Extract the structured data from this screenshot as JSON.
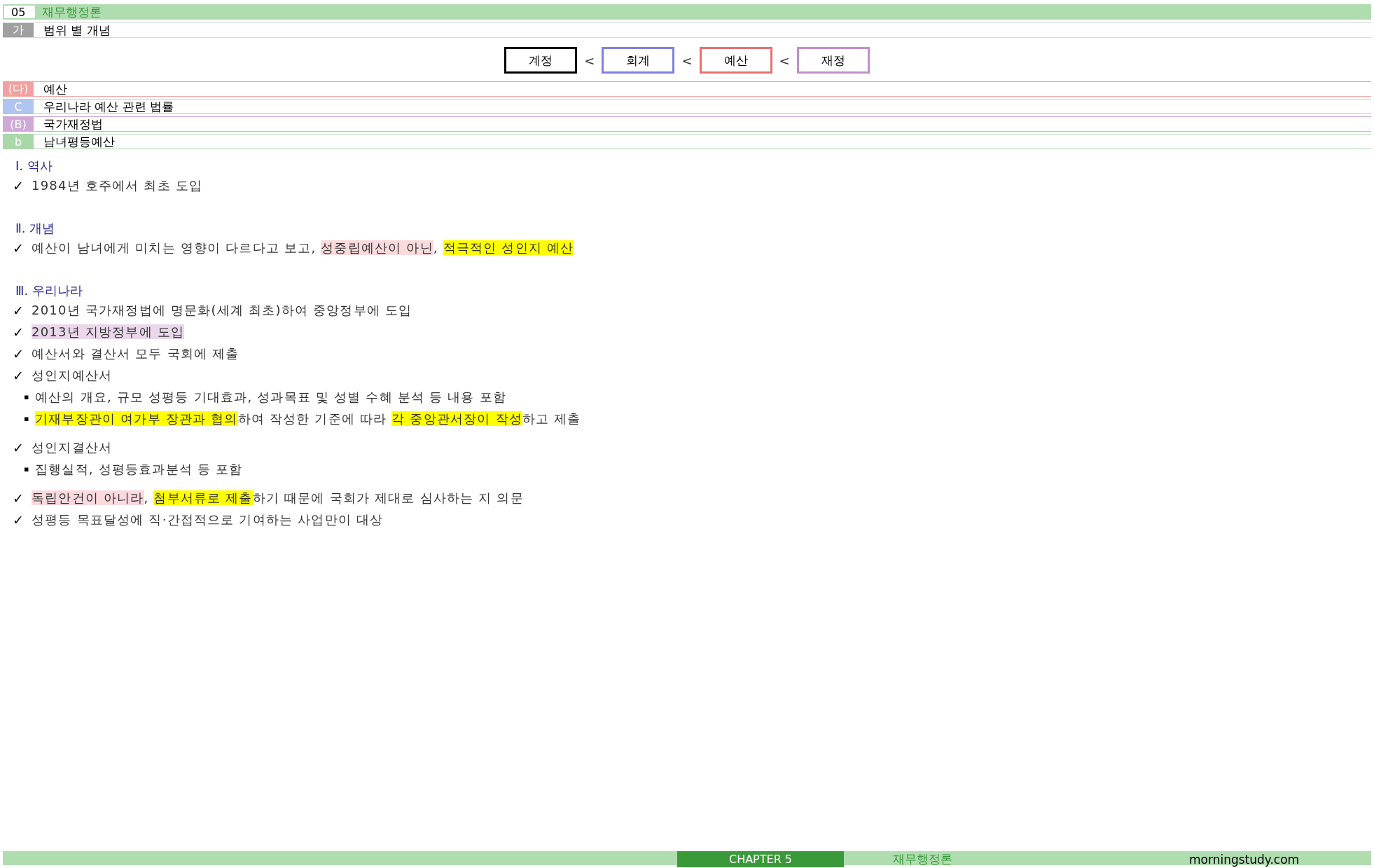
{
  "header": {
    "number": "05",
    "title": "재무행정론"
  },
  "subheading": {
    "tag": "가",
    "title": "범위 별 개념",
    "color": "#a0a0a0"
  },
  "scope_chain": [
    {
      "label": "계정",
      "color": "#000000"
    },
    {
      "separator": "<",
      "label": "회계",
      "color": "#8080e0"
    },
    {
      "separator": "<",
      "label": "예산",
      "color": "#e87070"
    },
    {
      "separator": "<",
      "label": "재정",
      "color": "#c090c8"
    }
  ],
  "topic_rows": [
    {
      "tag": "(다)",
      "title": "예산",
      "color": "#f4a0a0"
    },
    {
      "tag": "C",
      "title": "우리나라 예산 관련 법률",
      "color": "#b0c4f0"
    },
    {
      "tag": "(B)",
      "title": "국가재정법",
      "color": "#d0a8d8"
    },
    {
      "tag": "b",
      "title": "남녀평등예산",
      "color": "#a8d8a8"
    }
  ],
  "sections": [
    {
      "heading": "Ⅰ. 역사",
      "blocks": [
        [
          {
            "kind": "check",
            "marker": "✓",
            "parts": [
              {
                "text": "1984년 호주에서 최초 도입"
              }
            ]
          }
        ]
      ]
    },
    {
      "heading": "Ⅱ. 개념",
      "blocks": [
        [
          {
            "kind": "check",
            "marker": "✓",
            "parts": [
              {
                "text": "예산이 남녀에게 미치는 영향이 다르다고 보고, "
              },
              {
                "text": "성중립예산이 아닌",
                "color": "#fadadd"
              },
              {
                "text": ", "
              },
              {
                "text": "적극적인 성인지 예산",
                "color": "#ffff00"
              }
            ]
          }
        ]
      ]
    },
    {
      "heading": "Ⅲ. 우리나라",
      "blocks": [
        [
          {
            "kind": "check",
            "marker": "✓",
            "parts": [
              {
                "text": "2010년 국가재정법에 명문화(세계 최초)하여 중앙정부에 도입"
              }
            ]
          },
          {
            "kind": "check",
            "marker": "✓",
            "parts": [
              {
                "text": "2013년 지방정부에 도입",
                "color": "#ead7ea"
              }
            ]
          },
          {
            "kind": "check",
            "marker": "✓",
            "parts": [
              {
                "text": "예산서와 결산서 모두 국회에 제출"
              }
            ]
          },
          {
            "kind": "check",
            "marker": "✓",
            "parts": [
              {
                "text": "성인지예산서"
              }
            ]
          },
          {
            "kind": "bullet",
            "marker": "▪",
            "parts": [
              {
                "text": "예산의 개요, 규모 성평등 기대효과, 성과목표 및 성별 수혜 분석 등 내용 포함"
              }
            ]
          },
          {
            "kind": "bullet",
            "marker": "▪",
            "parts": [
              {
                "text": "기재부장관이 여가부 장관과 협의",
                "color": "#ffff00"
              },
              {
                "text": "하여 작성한 기준에 따라 "
              },
              {
                "text": "각 중앙관서장이 작성",
                "color": "#ffff00"
              },
              {
                "text": "하고 제출"
              }
            ]
          }
        ],
        [
          {
            "kind": "check",
            "marker": "✓",
            "parts": [
              {
                "text": "성인지결산서"
              }
            ]
          },
          {
            "kind": "bullet",
            "marker": "▪",
            "parts": [
              {
                "text": "집행실적, 성평등효과분석 등 포함"
              }
            ]
          }
        ],
        [
          {
            "kind": "check",
            "marker": "✓",
            "parts": [
              {
                "text": "독립안건이 아니라",
                "color": "#fadadd"
              },
              {
                "text": ", "
              },
              {
                "text": "첨부서류로 제출",
                "color": "#ffff00"
              },
              {
                "text": "하기 때문에 국회가 제대로 심사하는 지 의문"
              }
            ]
          },
          {
            "kind": "check",
            "marker": "✓",
            "parts": [
              {
                "text": "성평등 목표달성에 직·간접적으로 기여하는 사업만이 대상"
              }
            ]
          }
        ]
      ]
    }
  ],
  "footer": {
    "chapter": "CHAPTER 5",
    "subject": "재무행정론",
    "site": "morningstudy.com"
  }
}
